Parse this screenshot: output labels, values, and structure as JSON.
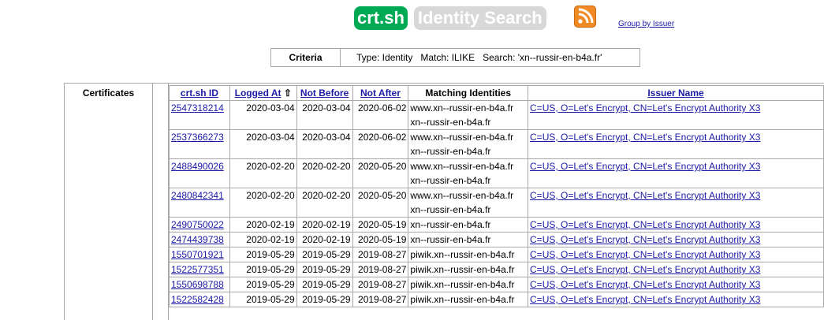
{
  "header": {
    "logo_main": "crt.sh",
    "logo_sub": "Identity Search",
    "group_link": "Group by Issuer"
  },
  "criteria": {
    "label": "Criteria",
    "value": "Type: Identity   Match: ILIKE   Search: 'xn--russir-en-b4a.fr'"
  },
  "section_label": "Certificates",
  "columns": {
    "id": "crt.sh ID",
    "logged_at": "Logged At",
    "sort_arrow": "⇧",
    "not_before": "Not Before",
    "not_after": "Not After",
    "identities": "Matching Identities",
    "issuer": "Issuer Name"
  },
  "rows": [
    {
      "id": "2547318214",
      "logged": "2020-03-04",
      "nb": "2020-03-04",
      "na": "2020-06-02",
      "ident1": "www.xn--russir-en-b4a.fr",
      "ident2": "xn--russir-en-b4a.fr",
      "issuer": "C=US, O=Let's Encrypt, CN=Let's Encrypt Authority X3"
    },
    {
      "id": "2537366273",
      "logged": "2020-03-04",
      "nb": "2020-03-04",
      "na": "2020-06-02",
      "ident1": "www.xn--russir-en-b4a.fr",
      "ident2": "xn--russir-en-b4a.fr",
      "issuer": "C=US, O=Let's Encrypt, CN=Let's Encrypt Authority X3"
    },
    {
      "id": "2488490026",
      "logged": "2020-02-20",
      "nb": "2020-02-20",
      "na": "2020-05-20",
      "ident1": "www.xn--russir-en-b4a.fr",
      "ident2": "xn--russir-en-b4a.fr",
      "issuer": "C=US, O=Let's Encrypt, CN=Let's Encrypt Authority X3"
    },
    {
      "id": "2480842341",
      "logged": "2020-02-20",
      "nb": "2020-02-20",
      "na": "2020-05-20",
      "ident1": "www.xn--russir-en-b4a.fr",
      "ident2": "xn--russir-en-b4a.fr",
      "issuer": "C=US, O=Let's Encrypt, CN=Let's Encrypt Authority X3"
    },
    {
      "id": "2490750022",
      "logged": "2020-02-19",
      "nb": "2020-02-19",
      "na": "2020-05-19",
      "ident1": "xn--russir-en-b4a.fr",
      "ident2": "",
      "issuer": "C=US, O=Let's Encrypt, CN=Let's Encrypt Authority X3"
    },
    {
      "id": "2474439738",
      "logged": "2020-02-19",
      "nb": "2020-02-19",
      "na": "2020-05-19",
      "ident1": "xn--russir-en-b4a.fr",
      "ident2": "",
      "issuer": "C=US, O=Let's Encrypt, CN=Let's Encrypt Authority X3"
    },
    {
      "id": "1550701921",
      "logged": "2019-05-29",
      "nb": "2019-05-29",
      "na": "2019-08-27",
      "ident1": "piwik.xn--russir-en-b4a.fr",
      "ident2": "",
      "issuer": "C=US, O=Let's Encrypt, CN=Let's Encrypt Authority X3"
    },
    {
      "id": "1522577351",
      "logged": "2019-05-29",
      "nb": "2019-05-29",
      "na": "2019-08-27",
      "ident1": "piwik.xn--russir-en-b4a.fr",
      "ident2": "",
      "issuer": "C=US, O=Let's Encrypt, CN=Let's Encrypt Authority X3"
    },
    {
      "id": "1550698788",
      "logged": "2019-05-29",
      "nb": "2019-05-29",
      "na": "2019-08-27",
      "ident1": "piwik.xn--russir-en-b4a.fr",
      "ident2": "",
      "issuer": "C=US, O=Let's Encrypt, CN=Let's Encrypt Authority X3"
    },
    {
      "id": "1522582428",
      "logged": "2019-05-29",
      "nb": "2019-05-29",
      "na": "2019-08-27",
      "ident1": "piwik.xn--russir-en-b4a.fr",
      "ident2": "",
      "issuer": "C=US, O=Let's Encrypt, CN=Let's Encrypt Authority X3"
    }
  ]
}
